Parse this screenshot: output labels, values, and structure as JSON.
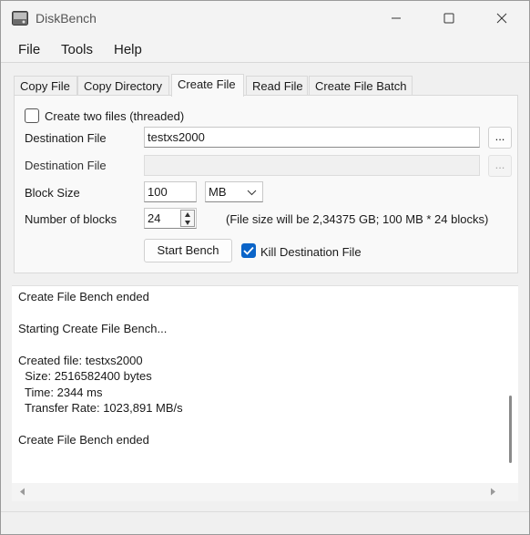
{
  "window": {
    "title": "DiskBench"
  },
  "menu": {
    "file": "File",
    "tools": "Tools",
    "help": "Help"
  },
  "tabs": [
    {
      "label": "Copy File"
    },
    {
      "label": "Copy Directory"
    },
    {
      "label": "Create File"
    },
    {
      "label": "Read File"
    },
    {
      "label": "Create File Batch"
    }
  ],
  "form": {
    "two_files_label": "Create two files (threaded)",
    "two_files_checked": false,
    "dest1_label": "Destination File",
    "dest1_value": "testxs2000",
    "browse1_label": "...",
    "dest2_label": "Destination File",
    "dest2_value": "",
    "browse2_label": "...",
    "block_size_label": "Block Size",
    "block_size_value": "100",
    "block_unit": "MB",
    "num_blocks_label": "Number of blocks",
    "num_blocks_value": "24",
    "file_size_info": "(File size will be 2,34375 GB; 100 MB * 24 blocks)",
    "start_button": "Start Bench",
    "kill_label": "Kill Destination File",
    "kill_checked": true
  },
  "log": {
    "lines": [
      "Create File Bench ended",
      "",
      "Starting Create File Bench...",
      "",
      "Created file: testxs2000",
      "  Size: 2516582400 bytes",
      "  Time: 2344 ms",
      "  Transfer Rate: 1023,891 MB/s",
      "",
      "Create File Bench ended"
    ]
  },
  "colors": {
    "accent": "#0a64c8"
  }
}
